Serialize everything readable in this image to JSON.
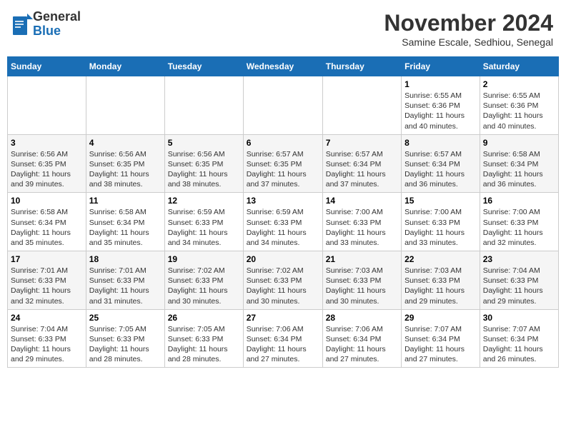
{
  "header": {
    "logo_general": "General",
    "logo_blue": "Blue",
    "month_title": "November 2024",
    "location": "Samine Escale, Sedhiou, Senegal"
  },
  "days_of_week": [
    "Sunday",
    "Monday",
    "Tuesday",
    "Wednesday",
    "Thursday",
    "Friday",
    "Saturday"
  ],
  "weeks": [
    [
      {
        "day": "",
        "info": ""
      },
      {
        "day": "",
        "info": ""
      },
      {
        "day": "",
        "info": ""
      },
      {
        "day": "",
        "info": ""
      },
      {
        "day": "",
        "info": ""
      },
      {
        "day": "1",
        "info": "Sunrise: 6:55 AM\nSunset: 6:36 PM\nDaylight: 11 hours\nand 40 minutes."
      },
      {
        "day": "2",
        "info": "Sunrise: 6:55 AM\nSunset: 6:36 PM\nDaylight: 11 hours\nand 40 minutes."
      }
    ],
    [
      {
        "day": "3",
        "info": "Sunrise: 6:56 AM\nSunset: 6:35 PM\nDaylight: 11 hours\nand 39 minutes."
      },
      {
        "day": "4",
        "info": "Sunrise: 6:56 AM\nSunset: 6:35 PM\nDaylight: 11 hours\nand 38 minutes."
      },
      {
        "day": "5",
        "info": "Sunrise: 6:56 AM\nSunset: 6:35 PM\nDaylight: 11 hours\nand 38 minutes."
      },
      {
        "day": "6",
        "info": "Sunrise: 6:57 AM\nSunset: 6:35 PM\nDaylight: 11 hours\nand 37 minutes."
      },
      {
        "day": "7",
        "info": "Sunrise: 6:57 AM\nSunset: 6:34 PM\nDaylight: 11 hours\nand 37 minutes."
      },
      {
        "day": "8",
        "info": "Sunrise: 6:57 AM\nSunset: 6:34 PM\nDaylight: 11 hours\nand 36 minutes."
      },
      {
        "day": "9",
        "info": "Sunrise: 6:58 AM\nSunset: 6:34 PM\nDaylight: 11 hours\nand 36 minutes."
      }
    ],
    [
      {
        "day": "10",
        "info": "Sunrise: 6:58 AM\nSunset: 6:34 PM\nDaylight: 11 hours\nand 35 minutes."
      },
      {
        "day": "11",
        "info": "Sunrise: 6:58 AM\nSunset: 6:34 PM\nDaylight: 11 hours\nand 35 minutes."
      },
      {
        "day": "12",
        "info": "Sunrise: 6:59 AM\nSunset: 6:33 PM\nDaylight: 11 hours\nand 34 minutes."
      },
      {
        "day": "13",
        "info": "Sunrise: 6:59 AM\nSunset: 6:33 PM\nDaylight: 11 hours\nand 34 minutes."
      },
      {
        "day": "14",
        "info": "Sunrise: 7:00 AM\nSunset: 6:33 PM\nDaylight: 11 hours\nand 33 minutes."
      },
      {
        "day": "15",
        "info": "Sunrise: 7:00 AM\nSunset: 6:33 PM\nDaylight: 11 hours\nand 33 minutes."
      },
      {
        "day": "16",
        "info": "Sunrise: 7:00 AM\nSunset: 6:33 PM\nDaylight: 11 hours\nand 32 minutes."
      }
    ],
    [
      {
        "day": "17",
        "info": "Sunrise: 7:01 AM\nSunset: 6:33 PM\nDaylight: 11 hours\nand 32 minutes."
      },
      {
        "day": "18",
        "info": "Sunrise: 7:01 AM\nSunset: 6:33 PM\nDaylight: 11 hours\nand 31 minutes."
      },
      {
        "day": "19",
        "info": "Sunrise: 7:02 AM\nSunset: 6:33 PM\nDaylight: 11 hours\nand 30 minutes."
      },
      {
        "day": "20",
        "info": "Sunrise: 7:02 AM\nSunset: 6:33 PM\nDaylight: 11 hours\nand 30 minutes."
      },
      {
        "day": "21",
        "info": "Sunrise: 7:03 AM\nSunset: 6:33 PM\nDaylight: 11 hours\nand 30 minutes."
      },
      {
        "day": "22",
        "info": "Sunrise: 7:03 AM\nSunset: 6:33 PM\nDaylight: 11 hours\nand 29 minutes."
      },
      {
        "day": "23",
        "info": "Sunrise: 7:04 AM\nSunset: 6:33 PM\nDaylight: 11 hours\nand 29 minutes."
      }
    ],
    [
      {
        "day": "24",
        "info": "Sunrise: 7:04 AM\nSunset: 6:33 PM\nDaylight: 11 hours\nand 29 minutes."
      },
      {
        "day": "25",
        "info": "Sunrise: 7:05 AM\nSunset: 6:33 PM\nDaylight: 11 hours\nand 28 minutes."
      },
      {
        "day": "26",
        "info": "Sunrise: 7:05 AM\nSunset: 6:33 PM\nDaylight: 11 hours\nand 28 minutes."
      },
      {
        "day": "27",
        "info": "Sunrise: 7:06 AM\nSunset: 6:34 PM\nDaylight: 11 hours\nand 27 minutes."
      },
      {
        "day": "28",
        "info": "Sunrise: 7:06 AM\nSunset: 6:34 PM\nDaylight: 11 hours\nand 27 minutes."
      },
      {
        "day": "29",
        "info": "Sunrise: 7:07 AM\nSunset: 6:34 PM\nDaylight: 11 hours\nand 27 minutes."
      },
      {
        "day": "30",
        "info": "Sunrise: 7:07 AM\nSunset: 6:34 PM\nDaylight: 11 hours\nand 26 minutes."
      }
    ]
  ]
}
